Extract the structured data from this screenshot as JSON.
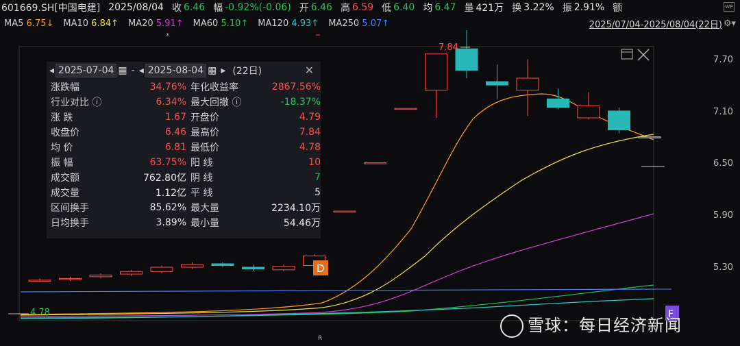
{
  "header": {
    "code": "601669.SH[中国电建]",
    "date": "2025/08/04",
    "close_label": "收",
    "close": "6.46",
    "change_label": "幅",
    "change": "-0.92%(-0.06)",
    "open_label": "开",
    "open": "6.46",
    "high_label": "高",
    "high": "6.59",
    "low_label": "低",
    "low": "6.40",
    "avg_label": "均",
    "avg": "6.47",
    "vol_label": "量",
    "vol": "421万",
    "turnover_label": "换",
    "turnover": "3.22%",
    "amp_label": "振",
    "amp": "2.91%",
    "amount_label": "额"
  },
  "ma": [
    {
      "name": "MA5",
      "value": "6.75↓",
      "color": "#ff9f1a"
    },
    {
      "name": "MA10",
      "value": "6.84↑",
      "color": "#f0e040"
    },
    {
      "name": "MA20",
      "value": "5.91↑",
      "color": "#d040d0"
    },
    {
      "name": "MA60",
      "value": "5.10↑",
      "color": "#1fc45a"
    },
    {
      "name": "MA120",
      "value": "4.93↑",
      "color": "#28c8c8"
    },
    {
      "name": "MA250",
      "value": "5.07↑",
      "color": "#4a7bff"
    }
  ],
  "range_label": "2025/07/04-2025/08/04(22日)",
  "wp_icon": "WP",
  "panel": {
    "start_date": "2025-07-04",
    "sep": "-",
    "end_date": "2025-08-04",
    "days": "(22日)",
    "rows": [
      {
        "l1": "涨跌幅",
        "v1": "34.76%",
        "c1": "red",
        "l2": "年化收益率",
        "v2": "2867.56%",
        "c2": "red"
      },
      {
        "l1": "行业对比 ⓘ",
        "v1": "6.34%",
        "c1": "red",
        "l2": "最大回撤 ⓘ",
        "v2": "-18.37%",
        "c2": "green"
      },
      {
        "l1": "涨  跌",
        "v1": "1.67",
        "c1": "red",
        "l2": "开盘价",
        "v2": "4.79",
        "c2": "red"
      },
      {
        "l1": "收盘价",
        "v1": "6.46",
        "c1": "red",
        "l2": "最高价",
        "v2": "7.84",
        "c2": "red"
      },
      {
        "l1": "均  价",
        "v1": "6.81",
        "c1": "red",
        "l2": "最低价",
        "v2": "4.78",
        "c2": "red"
      },
      {
        "l1": "振  幅",
        "v1": "63.75%",
        "c1": "red",
        "l2": "阳  线",
        "v2": "10",
        "c2": "red"
      },
      {
        "l1": "成交额",
        "v1": "762.80亿",
        "c1": "white",
        "l2": "阴  线",
        "v2": "7",
        "c2": "green"
      },
      {
        "l1": "成交量",
        "v1": "1.12亿",
        "c1": "white",
        "l2": "平  线",
        "v2": "5",
        "c2": "white"
      },
      {
        "l1": "区间换手",
        "v1": "85.62%",
        "c1": "white",
        "l2": "最大量",
        "v2": "2234.10万",
        "c2": "white"
      },
      {
        "l1": "日均换手",
        "v1": "3.89%",
        "c1": "white",
        "l2": "最小量",
        "v2": "54.46万",
        "c2": "white"
      }
    ]
  },
  "y_axis": [
    "7.70",
    "7.10",
    "6.50",
    "5.90",
    "5.30"
  ],
  "high_mark": "7.84",
  "low_mark": "4.78",
  "d_marker": "D",
  "f_marker": "F",
  "r_marker": "R",
  "star_marker": "*",
  "watermark": "雪球：每日经济新闻",
  "chart_data": {
    "type": "candlestick",
    "y_ticks": [
      7.7,
      7.1,
      6.5,
      5.9,
      5.3
    ],
    "candles": [
      {
        "o": 4.79,
        "c": 4.8,
        "h": 4.82,
        "l": 4.78
      },
      {
        "o": 4.81,
        "c": 4.82,
        "h": 4.84,
        "l": 4.79
      },
      {
        "o": 4.84,
        "c": 4.86,
        "h": 4.88,
        "l": 4.82
      },
      {
        "o": 4.87,
        "c": 4.9,
        "h": 4.92,
        "l": 4.85
      },
      {
        "o": 4.9,
        "c": 4.95,
        "h": 4.97,
        "l": 4.88
      },
      {
        "o": 4.95,
        "c": 4.98,
        "h": 5.01,
        "l": 4.93
      },
      {
        "o": 4.99,
        "c": 4.97,
        "h": 5.01,
        "l": 4.95
      },
      {
        "o": 4.95,
        "c": 4.93,
        "h": 4.98,
        "l": 4.91
      },
      {
        "o": 4.92,
        "c": 4.96,
        "h": 4.98,
        "l": 4.9
      },
      {
        "o": 4.97,
        "c": 5.08,
        "h": 5.1,
        "l": 4.95
      },
      {
        "o": 5.59,
        "c": 5.6,
        "h": 5.6,
        "l": 5.59
      },
      {
        "o": 6.15,
        "c": 6.16,
        "h": 6.16,
        "l": 6.15
      },
      {
        "o": 6.78,
        "c": 6.79,
        "h": 6.79,
        "l": 6.78
      },
      {
        "o": 7.0,
        "c": 7.42,
        "h": 7.42,
        "l": 6.68
      },
      {
        "o": 7.48,
        "c": 7.23,
        "h": 7.84,
        "l": 7.14
      },
      {
        "o": 7.1,
        "c": 7.06,
        "h": 7.3,
        "l": 6.9
      },
      {
        "o": 7.0,
        "c": 7.14,
        "h": 7.36,
        "l": 6.7
      },
      {
        "o": 6.9,
        "c": 6.8,
        "h": 7.02,
        "l": 6.78
      },
      {
        "o": 6.68,
        "c": 6.82,
        "h": 6.98,
        "l": 6.66
      },
      {
        "o": 6.76,
        "c": 6.54,
        "h": 6.8,
        "l": 6.5
      },
      {
        "o": 6.46,
        "c": 6.46,
        "h": 6.46,
        "l": 6.46
      }
    ]
  }
}
